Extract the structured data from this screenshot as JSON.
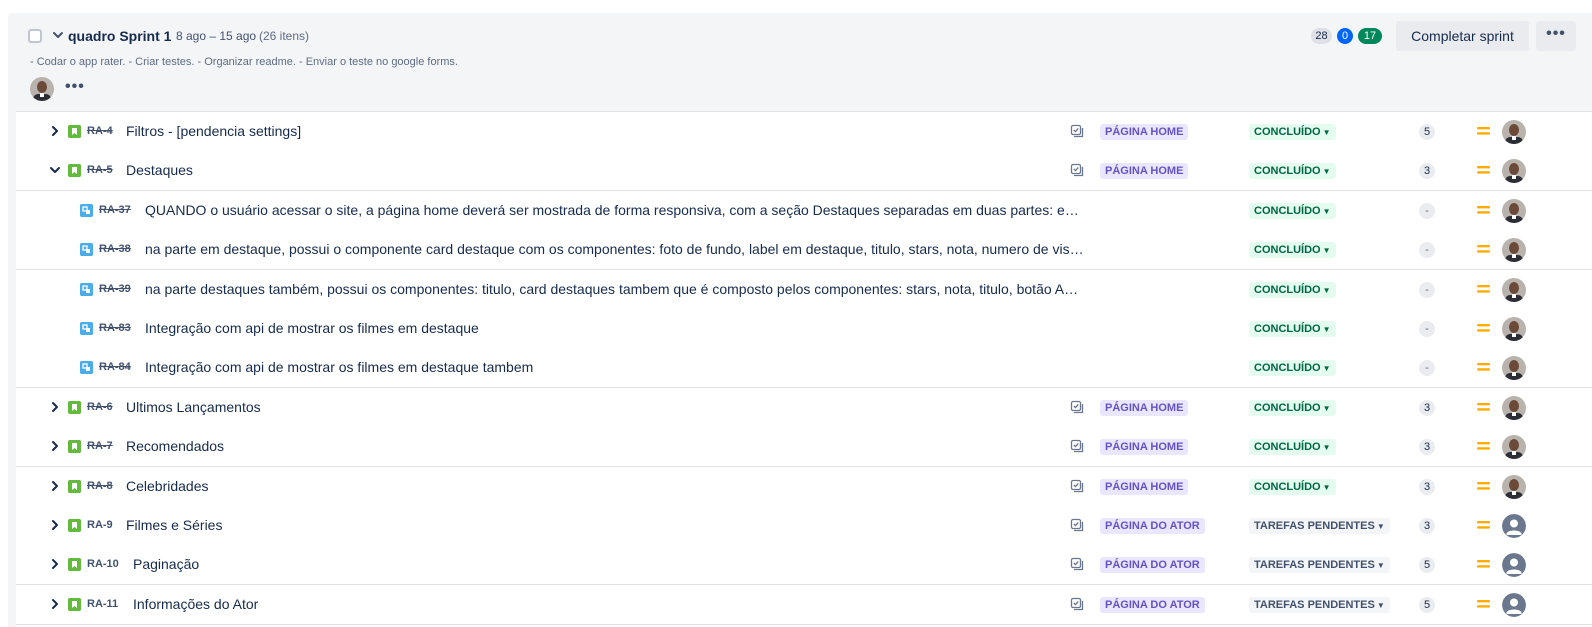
{
  "sprint": {
    "name": "quadro Sprint 1",
    "dates": "8 ago – 15 ago",
    "count": "(26 itens)",
    "goal": "- Codar o app rater. - Criar testes. - Organizar readme. - Enviar o teste no google forms.",
    "badge_todo": "28",
    "badge_progress": "0",
    "badge_done": "17",
    "complete_label": "Completar sprint",
    "more_label": "•••"
  },
  "colors": {
    "story": "#63ba3c",
    "subtask": "#4bade8",
    "epic_bg": "#eae6ff",
    "epic_text": "#6554c0",
    "done_bg": "#e3fcef",
    "done_text": "#006644",
    "priority": "#ffab00"
  },
  "rows": [
    {
      "key": "RA-4",
      "summary": "Filtros - [pendencia settings]",
      "epic": "PÁGINA HOME",
      "status": "CONCLUÍDO",
      "points": "5",
      "type": "story",
      "expanded": false
    },
    {
      "key": "RA-5",
      "summary": "Destaques",
      "epic": "PÁGINA HOME",
      "status": "CONCLUÍDO",
      "points": "3",
      "type": "story",
      "expanded": true
    },
    {
      "key": "RA-37",
      "summary": "QUANDO o usuário acessar o site, a página home deverá ser mostrada de forma responsiva, com a seção Destaques separadas em duas partes: em d…",
      "status": "CONCLUÍDO",
      "points": "-",
      "type": "subtask"
    },
    {
      "key": "RA-38",
      "summary": "na parte em destaque, possui o componente card destaque com os componentes: foto de fundo, label em destaque, titulo, stars, nota, numero de vis…",
      "status": "CONCLUÍDO",
      "points": "-",
      "type": "subtask"
    },
    {
      "key": "RA-39",
      "summary": "na parte destaques também, possui os componentes: titulo, card destaques tambem que é composto pelos componentes: stars, nota, titulo, botão A…",
      "status": "CONCLUÍDO",
      "points": "-",
      "type": "subtask"
    },
    {
      "key": "RA-83",
      "summary": "Integração com api de mostrar os filmes em destaque",
      "status": "CONCLUÍDO",
      "points": "-",
      "type": "subtask"
    },
    {
      "key": "RA-84",
      "summary": "Integração com api de mostrar os filmes em destaque tambem",
      "status": "CONCLUÍDO",
      "points": "-",
      "type": "subtask"
    },
    {
      "key": "RA-6",
      "summary": "Ultimos Lançamentos",
      "epic": "PÁGINA HOME",
      "status": "CONCLUÍDO",
      "points": "3",
      "type": "story",
      "expanded": false
    },
    {
      "key": "RA-7",
      "summary": "Recomendados",
      "epic": "PÁGINA HOME",
      "status": "CONCLUÍDO",
      "points": "3",
      "type": "story",
      "expanded": false
    },
    {
      "key": "RA-8",
      "summary": "Celebridades",
      "epic": "PÁGINA HOME",
      "status": "CONCLUÍDO",
      "points": "3",
      "type": "story",
      "expanded": false
    },
    {
      "key": "RA-9",
      "summary": "Filmes e Séries",
      "epic": "PÁGINA DO ATOR",
      "status": "TAREFAS PENDENTES",
      "points": "3",
      "type": "story",
      "expanded": false
    },
    {
      "key": "RA-10",
      "summary": "Paginação",
      "epic": "PÁGINA DO ATOR",
      "status": "TAREFAS PENDENTES",
      "points": "5",
      "type": "story",
      "expanded": false
    },
    {
      "key": "RA-11",
      "summary": "Informações do Ator",
      "epic": "PÁGINA DO ATOR",
      "status": "TAREFAS PENDENTES",
      "points": "5",
      "type": "story",
      "expanded": false
    }
  ]
}
